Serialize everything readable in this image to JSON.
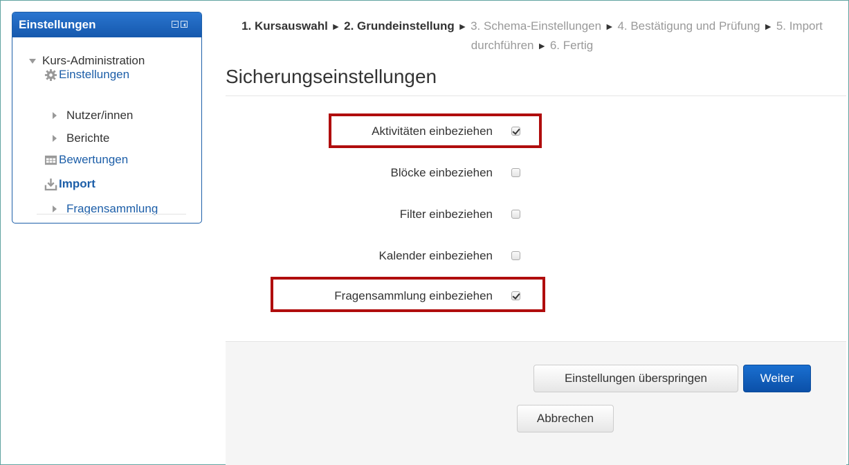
{
  "sidebar": {
    "title": "Einstellungen",
    "items": [
      {
        "label": "Kurs-Administration"
      },
      {
        "label": "Einstellungen"
      },
      {
        "label": "Nutzer/innen"
      },
      {
        "label": "Berichte"
      },
      {
        "label": "Bewertungen"
      },
      {
        "label": "Import"
      },
      {
        "label": "Fragensammlung"
      }
    ]
  },
  "steps": [
    {
      "label": "1. Kursauswahl",
      "state": "done"
    },
    {
      "label": "2. Grundeinstellung",
      "state": "current"
    },
    {
      "label": "3. Schema-Einstellungen",
      "state": "pending"
    },
    {
      "label": "4. Bestätigung und Prüfung",
      "state": "pending"
    },
    {
      "label": "5. Import durchführen",
      "state": "pending"
    },
    {
      "label": "6. Fertig",
      "state": "pending"
    }
  ],
  "step_separator": "►",
  "main": {
    "title": "Sicherungseinstellungen",
    "options": [
      {
        "label": "Aktivitäten einbeziehen",
        "checked": true
      },
      {
        "label": "Blöcke einbeziehen",
        "checked": false
      },
      {
        "label": "Filter einbeziehen",
        "checked": false
      },
      {
        "label": "Kalender einbeziehen",
        "checked": false
      },
      {
        "label": "Fragensammlung einbeziehen",
        "checked": true
      }
    ]
  },
  "buttons": {
    "skip": "Einstellungen überspringen",
    "next": "Weiter",
    "cancel": "Abbrechen"
  },
  "colors": {
    "accent": "#1a64bf",
    "link": "#1c5ea8",
    "highlight": "#b00d0d"
  }
}
